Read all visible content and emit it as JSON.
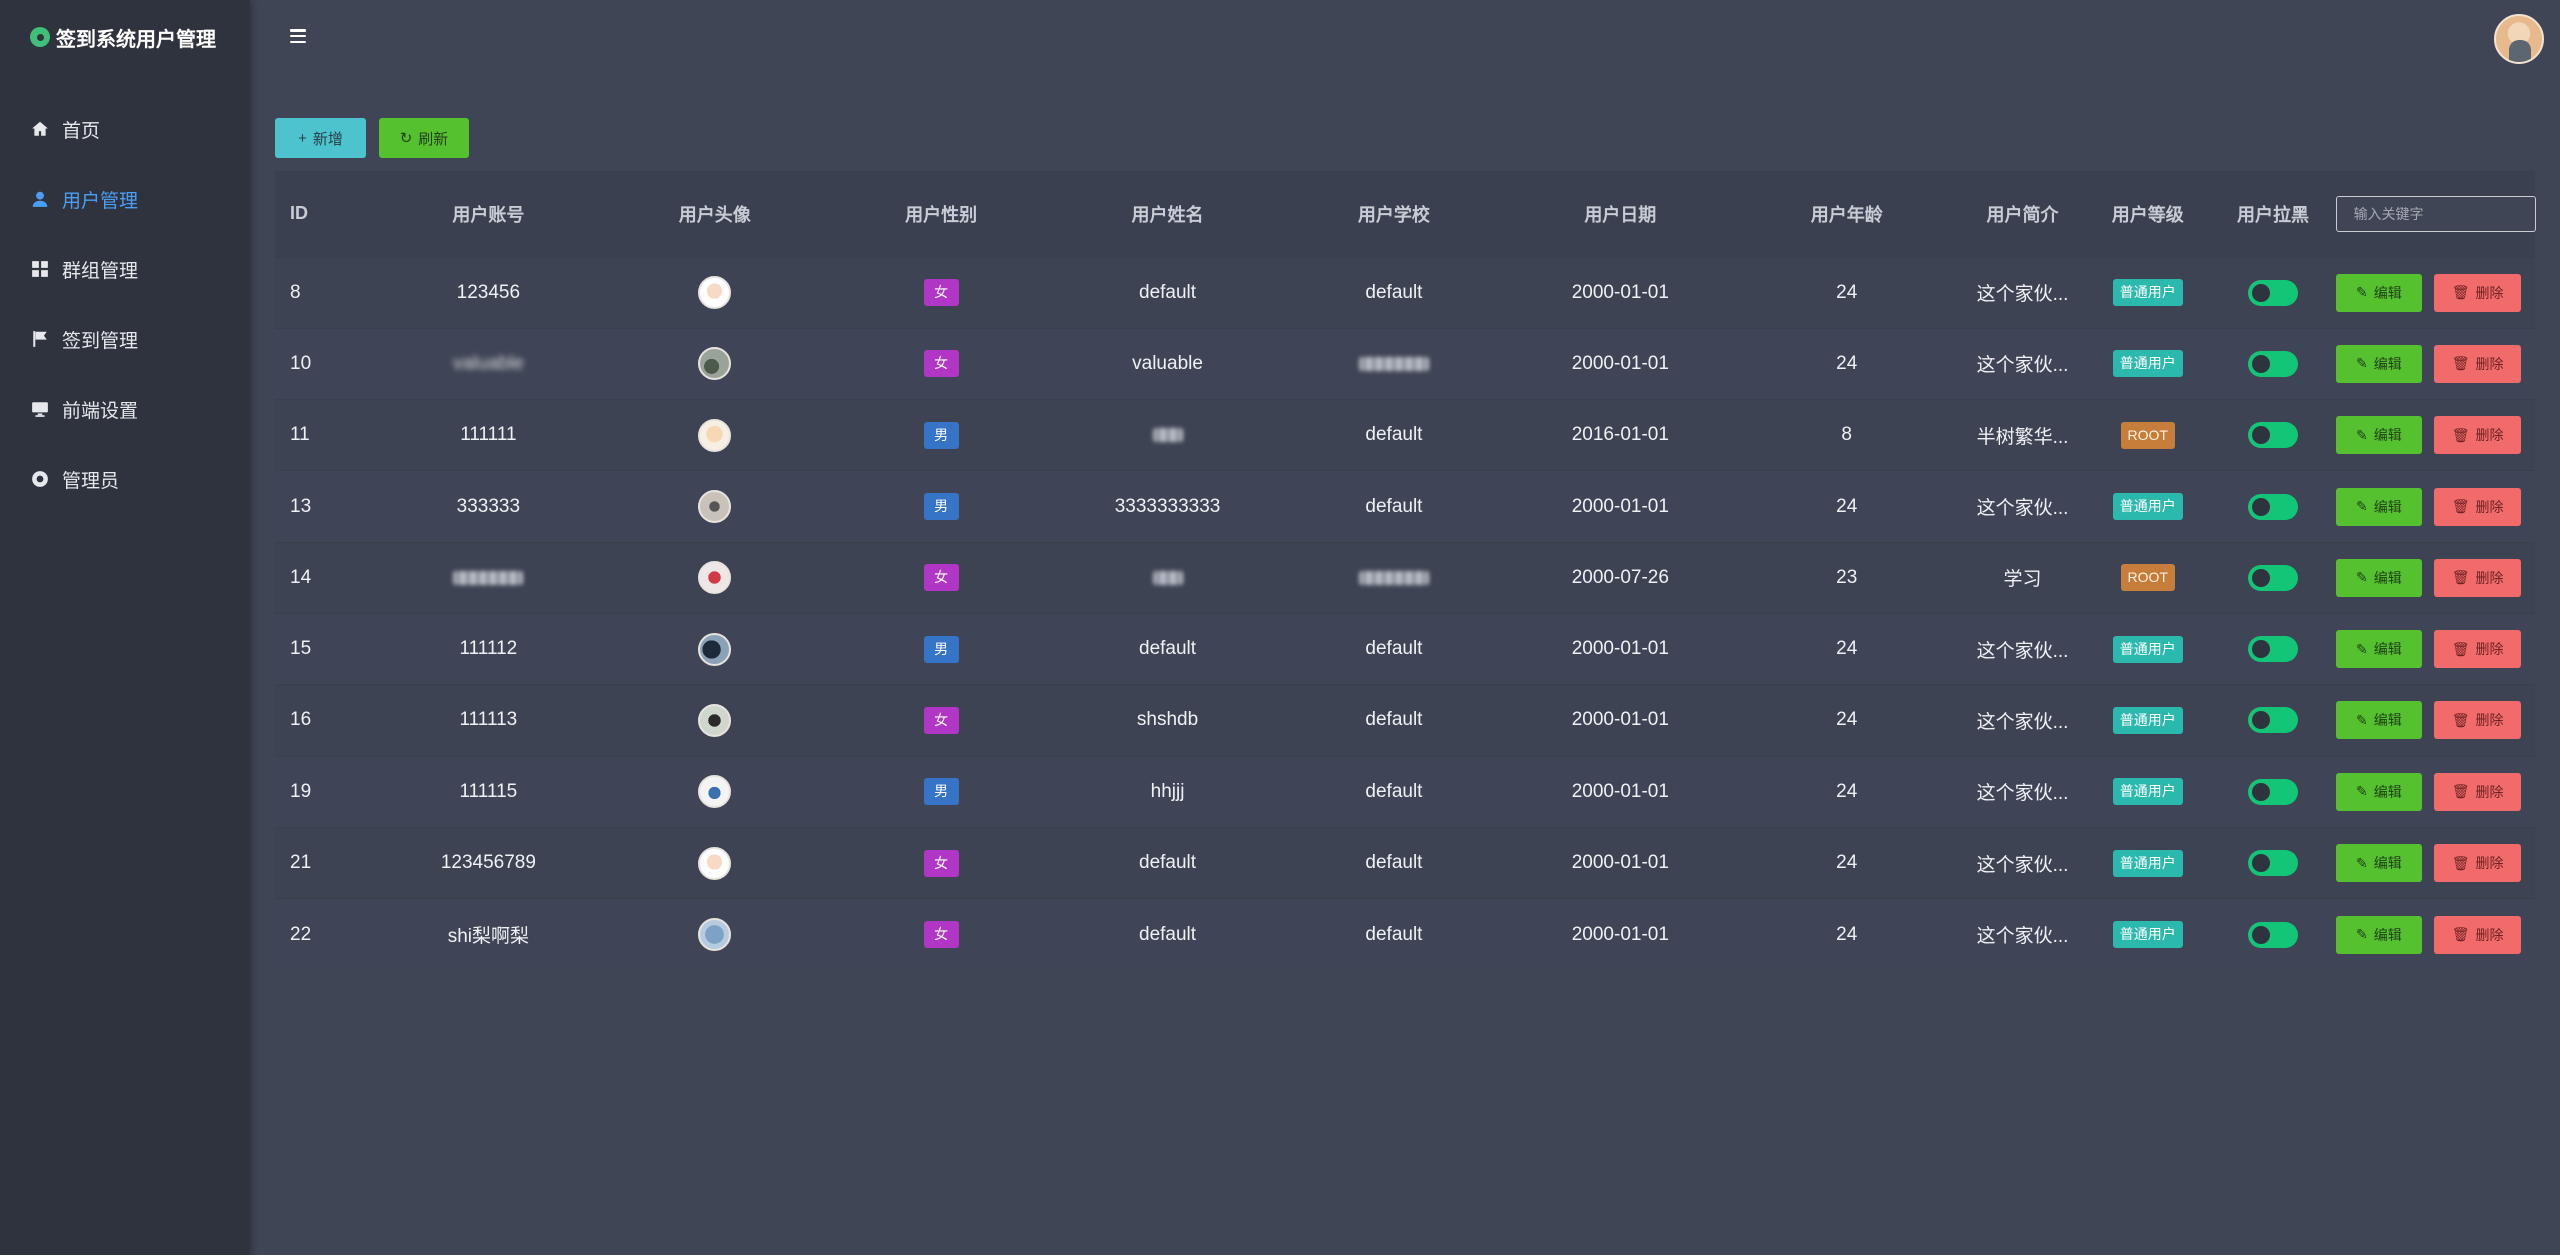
{
  "app": {
    "title": "签到系统用户管理"
  },
  "sidebar": {
    "items": [
      {
        "label": "首页",
        "icon": "home-icon",
        "active": false
      },
      {
        "label": "用户管理",
        "icon": "user-icon",
        "active": true
      },
      {
        "label": "群组管理",
        "icon": "grid-icon",
        "active": false
      },
      {
        "label": "签到管理",
        "icon": "flag-icon",
        "active": false
      },
      {
        "label": "前端设置",
        "icon": "monitor-icon",
        "active": false
      },
      {
        "label": "管理员",
        "icon": "admin-icon",
        "active": false
      }
    ]
  },
  "toolbar": {
    "add_label": "新增",
    "refresh_label": "刷新"
  },
  "search": {
    "placeholder": "输入关键字"
  },
  "table": {
    "headers": [
      "ID",
      "用户账号",
      "用户头像",
      "用户性别",
      "用户姓名",
      "用户学校",
      "用户日期",
      "用户年龄",
      "用户简介",
      "用户等级",
      "用户拉黑"
    ],
    "edit_label": "编辑",
    "delete_label": "删除",
    "rows": [
      {
        "id": "8",
        "account": "123456",
        "gender": "女",
        "name": "default",
        "school": "default",
        "date": "2000-01-01",
        "age": "24",
        "intro": "这个家伙...",
        "level": "普通用户",
        "blacklisted": true
      },
      {
        "id": "10",
        "account": "valuable",
        "gender": "女",
        "name": "valuable",
        "school": "",
        "date": "2000-01-01",
        "age": "24",
        "intro": "这个家伙...",
        "level": "普通用户",
        "blacklisted": true
      },
      {
        "id": "11",
        "account": "111111",
        "gender": "男",
        "name": "",
        "school": "default",
        "date": "2016-01-01",
        "age": "8",
        "intro": "半树繁华...",
        "level": "ROOT",
        "blacklisted": true
      },
      {
        "id": "13",
        "account": "333333",
        "gender": "男",
        "name": "3333333333",
        "school": "default",
        "date": "2000-01-01",
        "age": "24",
        "intro": "这个家伙...",
        "level": "普通用户",
        "blacklisted": true
      },
      {
        "id": "14",
        "account": "",
        "gender": "女",
        "name": "",
        "school": "",
        "date": "2000-07-26",
        "age": "23",
        "intro": "学习",
        "level": "ROOT",
        "blacklisted": true
      },
      {
        "id": "15",
        "account": "111112",
        "gender": "男",
        "name": "default",
        "school": "default",
        "date": "2000-01-01",
        "age": "24",
        "intro": "这个家伙...",
        "level": "普通用户",
        "blacklisted": true
      },
      {
        "id": "16",
        "account": "111113",
        "gender": "女",
        "name": "shshdb",
        "school": "default",
        "date": "2000-01-01",
        "age": "24",
        "intro": "这个家伙...",
        "level": "普通用户",
        "blacklisted": true
      },
      {
        "id": "19",
        "account": "111115",
        "gender": "男",
        "name": "hhjjj",
        "school": "default",
        "date": "2000-01-01",
        "age": "24",
        "intro": "这个家伙...",
        "level": "普通用户",
        "blacklisted": true
      },
      {
        "id": "21",
        "account": "123456789",
        "gender": "女",
        "name": "default",
        "school": "default",
        "date": "2000-01-01",
        "age": "24",
        "intro": "这个家伙...",
        "level": "普通用户",
        "blacklisted": true
      },
      {
        "id": "22",
        "account": "shi梨啊梨",
        "gender": "女",
        "name": "default",
        "school": "default",
        "date": "2000-01-01",
        "age": "24",
        "intro": "这个家伙...",
        "level": "普通用户",
        "blacklisted": true
      }
    ]
  }
}
